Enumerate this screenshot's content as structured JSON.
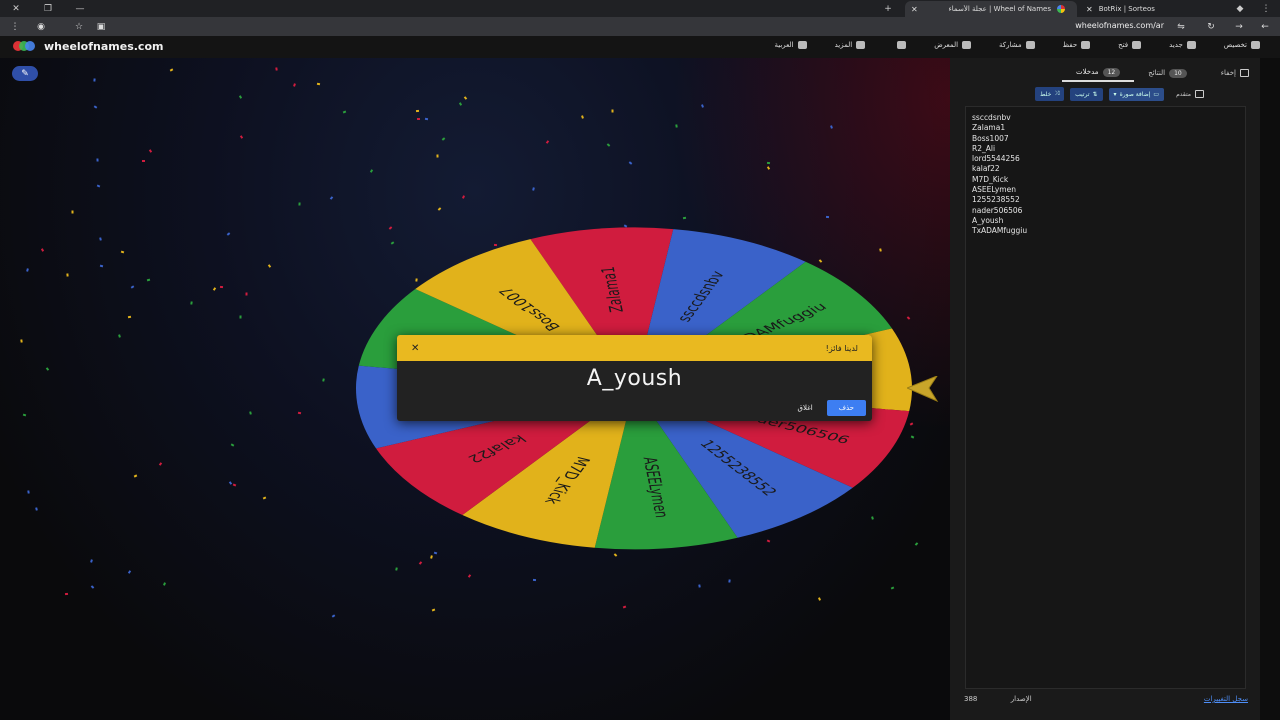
{
  "browser": {
    "tabs": [
      {
        "label": "Wheel of Names | عجلة الأسماء",
        "active": true
      },
      {
        "label": "BotRix | Sorteos",
        "active": false
      }
    ],
    "url": "wheelofnames.com/ar"
  },
  "header": {
    "logo_text": "wheelofnames.com",
    "menu": [
      {
        "label": "تخصيص",
        "icon": "palette-icon"
      },
      {
        "label": "جديد",
        "icon": "file-icon"
      },
      {
        "label": "فتح",
        "icon": "folder-icon"
      },
      {
        "label": "حفظ",
        "icon": "save-icon"
      },
      {
        "label": "مشاركة",
        "icon": "share-icon"
      },
      {
        "label": "المعرض",
        "icon": "search-icon"
      },
      {
        "label": "",
        "icon": "fullscreen-icon"
      },
      {
        "label": "المزيد",
        "icon": "chevron-down-icon"
      },
      {
        "label": "العربية",
        "icon": "globe-icon"
      }
    ]
  },
  "wheel": {
    "colors": [
      "#d01c3e",
      "#3a62c9",
      "#2a9e3c",
      "#e1b21b",
      "#d01c3e",
      "#3a62c9",
      "#2a9e3c",
      "#e1b21b",
      "#d01c3e",
      "#3a62c9",
      "#2a9e3c",
      "#e1b21b"
    ],
    "labels": [
      "Zalama1",
      "ssccdsnbv",
      "TxADAMfuggiu",
      "A_yoush",
      "nader506506",
      "1255238552",
      "ASEELymen",
      "M7D_Kick",
      "kalaf22",
      "lord5544256",
      "R2_Ali",
      "Boss1007"
    ]
  },
  "modal": {
    "title": "لدينا فائز!",
    "winner": "A_yoush",
    "remove_label": "حذف",
    "close_label": "اغلاق"
  },
  "panel": {
    "hide_label": "إخفاء",
    "results_label": "النتائج",
    "results_count": "10",
    "entries_label": "مدخلات",
    "entries_count": "12",
    "advanced_label": "متقدم",
    "tools": [
      "إضافة صورة",
      "ترتيب",
      "خلط"
    ],
    "entries": [
      "ssccdsnbv",
      "Zalama1",
      "Boss1007",
      "R2_Ali",
      "lord5544256",
      "kalaf22",
      "M7D_Kick",
      "ASEELymen",
      "1255238552",
      "nader506506",
      "A_yoush",
      "TxADAMfuggiu"
    ],
    "version_label": "الإصدار",
    "version": "388",
    "changelog_label": "سجل التغييرات"
  }
}
